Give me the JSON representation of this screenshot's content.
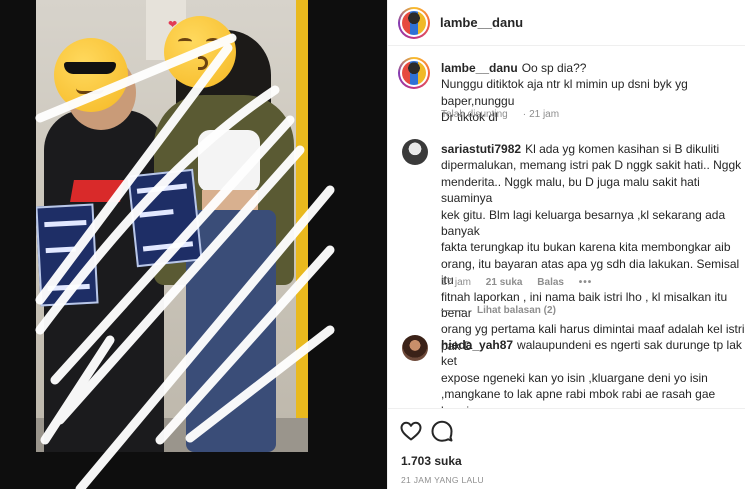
{
  "post": {
    "username": "lambe__danu",
    "caption": {
      "username": "lambe__danu",
      "text": "Oo sp dia??\nNunggu ditiktok aja ntr kl mimin up dsni byk yg baper,nunggu\nDr tiktok dl",
      "edited": "Telah disunting",
      "time": "21 jam"
    },
    "likes": "1.703 suka",
    "time_ago": "21 JAM YANG LALU"
  },
  "comments": [
    {
      "username": "sariastuti7982",
      "text": "Kl ada yg komen kasihan si B dikuliti\ndipermalukan, memang istri pak D nggk sakit hati.. Nggk\nmenderita.. Nggk malu, bu D juga malu sakit hati suaminya\nkek gitu. Blm lagi keluarga besarnya ,kl sekarang ada banyak\nfakta terungkap itu bukan karena kita membongkar aib\norang, itu bayaran atas apa yg sdh dia lakukan. Semisal itu\nfitnah laporkan , ini nama baik istri lho , kl misalkan itu benar\norang yg pertama kali harus dimintai maaf adalah kel istri\npak D",
      "time": "17 jam",
      "likes": "21 suka",
      "reply": "Balas",
      "more": "•••",
      "view_replies": "Lihat balasan (2)"
    },
    {
      "username": "hieda_yah87",
      "text": "walaupundeni es ngerti sak durunge tp lak ket\nexpose ngeneki kan yo isin ,kluargane deni yo isin\n,mangkane to lak apne rabi mbok rabi ae rasah gae kepsion\nseng aneh aneh,seng jare bjone meneng lah,kalem lah,uduk\npenyanyi lah...dadi seng gak seneng kan golek golek ..ngerti"
    }
  ],
  "icons": {
    "like": "heart-icon",
    "comment": "comment-bubble-icon"
  },
  "colors": {
    "text": "#262626",
    "secondary": "#8e8e8e",
    "divider": "#efefef",
    "media_bg": "#0e0e0e"
  }
}
